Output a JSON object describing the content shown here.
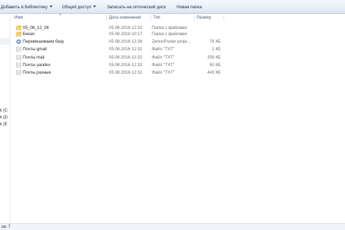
{
  "toolbar": {
    "library_label": "Добавить в библиотеку",
    "share_label": "Общий доступ",
    "burn_label": "Записать на оптический диск",
    "new_folder_label": "Новая папка"
  },
  "columns": {
    "name": "Имя",
    "date": "Дата изменения",
    "type": "Тип",
    "size": "Размер"
  },
  "files": [
    {
      "name": "05_08_12_06",
      "date": "05.08.2016 12:32",
      "type": "Папка с файлами",
      "size": "",
      "icon": "folder-icon"
    },
    {
      "name": "Бекап",
      "date": "05.08.2016 10:17",
      "type": "Папка с файлами",
      "size": "",
      "icon": "folder-icon"
    },
    {
      "name": "Перемешиваем базу",
      "date": "05.08.2016 12:36",
      "type": "ZennoPoster proje...",
      "size": "78 КБ",
      "icon": "zennoposter-project-icon"
    },
    {
      "name": "Почты gmail",
      "date": "05.08.2016 12:32",
      "type": "Файл \"TXT\"",
      "size": "1 КБ",
      "icon": "text-file-icon"
    },
    {
      "name": "Почты mail",
      "date": "05.08.2016 12:32",
      "type": "Файл \"TXT\"",
      "size": "359 КБ",
      "icon": "text-file-icon"
    },
    {
      "name": "Почты yandex",
      "date": "05.08.2016 12:32",
      "type": "Файл \"TXT\"",
      "size": "50 КБ",
      "icon": "text-file-icon"
    },
    {
      "name": "Почты разные",
      "date": "05.08.2016 12:32",
      "type": "Файл \"TXT\"",
      "size": "443 КБ",
      "icon": "text-file-icon"
    }
  ],
  "nav": {
    "drives": [
      "k (C",
      "k (D",
      "k (E"
    ]
  },
  "status": {
    "text": "ов: 7"
  },
  "colors": {
    "folder": "#e8c25a",
    "toolbar_bg": "#e6eef7",
    "header_text": "#4c607a"
  }
}
